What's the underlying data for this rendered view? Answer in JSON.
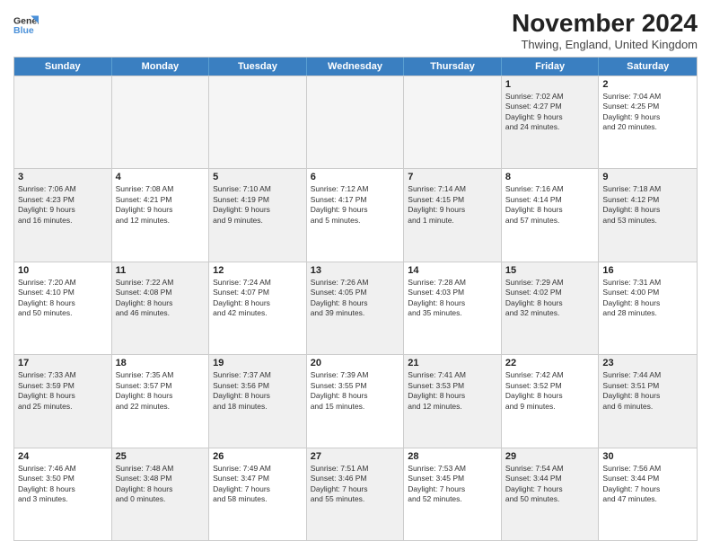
{
  "header": {
    "logo_line1": "General",
    "logo_line2": "Blue",
    "title": "November 2024",
    "location": "Thwing, England, United Kingdom"
  },
  "days_of_week": [
    "Sunday",
    "Monday",
    "Tuesday",
    "Wednesday",
    "Thursday",
    "Friday",
    "Saturday"
  ],
  "rows": [
    [
      {
        "day": "",
        "info": [],
        "empty": true
      },
      {
        "day": "",
        "info": [],
        "empty": true
      },
      {
        "day": "",
        "info": [],
        "empty": true
      },
      {
        "day": "",
        "info": [],
        "empty": true
      },
      {
        "day": "",
        "info": [],
        "empty": true
      },
      {
        "day": "1",
        "shaded": true,
        "info": [
          "Sunrise: 7:02 AM",
          "Sunset: 4:27 PM",
          "Daylight: 9 hours",
          "and 24 minutes."
        ]
      },
      {
        "day": "2",
        "info": [
          "Sunrise: 7:04 AM",
          "Sunset: 4:25 PM",
          "Daylight: 9 hours",
          "and 20 minutes."
        ]
      }
    ],
    [
      {
        "day": "3",
        "shaded": true,
        "info": [
          "Sunrise: 7:06 AM",
          "Sunset: 4:23 PM",
          "Daylight: 9 hours",
          "and 16 minutes."
        ]
      },
      {
        "day": "4",
        "info": [
          "Sunrise: 7:08 AM",
          "Sunset: 4:21 PM",
          "Daylight: 9 hours",
          "and 12 minutes."
        ]
      },
      {
        "day": "5",
        "shaded": true,
        "info": [
          "Sunrise: 7:10 AM",
          "Sunset: 4:19 PM",
          "Daylight: 9 hours",
          "and 9 minutes."
        ]
      },
      {
        "day": "6",
        "info": [
          "Sunrise: 7:12 AM",
          "Sunset: 4:17 PM",
          "Daylight: 9 hours",
          "and 5 minutes."
        ]
      },
      {
        "day": "7",
        "shaded": true,
        "info": [
          "Sunrise: 7:14 AM",
          "Sunset: 4:15 PM",
          "Daylight: 9 hours",
          "and 1 minute."
        ]
      },
      {
        "day": "8",
        "info": [
          "Sunrise: 7:16 AM",
          "Sunset: 4:14 PM",
          "Daylight: 8 hours",
          "and 57 minutes."
        ]
      },
      {
        "day": "9",
        "shaded": true,
        "info": [
          "Sunrise: 7:18 AM",
          "Sunset: 4:12 PM",
          "Daylight: 8 hours",
          "and 53 minutes."
        ]
      }
    ],
    [
      {
        "day": "10",
        "info": [
          "Sunrise: 7:20 AM",
          "Sunset: 4:10 PM",
          "Daylight: 8 hours",
          "and 50 minutes."
        ]
      },
      {
        "day": "11",
        "shaded": true,
        "info": [
          "Sunrise: 7:22 AM",
          "Sunset: 4:08 PM",
          "Daylight: 8 hours",
          "and 46 minutes."
        ]
      },
      {
        "day": "12",
        "info": [
          "Sunrise: 7:24 AM",
          "Sunset: 4:07 PM",
          "Daylight: 8 hours",
          "and 42 minutes."
        ]
      },
      {
        "day": "13",
        "shaded": true,
        "info": [
          "Sunrise: 7:26 AM",
          "Sunset: 4:05 PM",
          "Daylight: 8 hours",
          "and 39 minutes."
        ]
      },
      {
        "day": "14",
        "info": [
          "Sunrise: 7:28 AM",
          "Sunset: 4:03 PM",
          "Daylight: 8 hours",
          "and 35 minutes."
        ]
      },
      {
        "day": "15",
        "shaded": true,
        "info": [
          "Sunrise: 7:29 AM",
          "Sunset: 4:02 PM",
          "Daylight: 8 hours",
          "and 32 minutes."
        ]
      },
      {
        "day": "16",
        "info": [
          "Sunrise: 7:31 AM",
          "Sunset: 4:00 PM",
          "Daylight: 8 hours",
          "and 28 minutes."
        ]
      }
    ],
    [
      {
        "day": "17",
        "shaded": true,
        "info": [
          "Sunrise: 7:33 AM",
          "Sunset: 3:59 PM",
          "Daylight: 8 hours",
          "and 25 minutes."
        ]
      },
      {
        "day": "18",
        "info": [
          "Sunrise: 7:35 AM",
          "Sunset: 3:57 PM",
          "Daylight: 8 hours",
          "and 22 minutes."
        ]
      },
      {
        "day": "19",
        "shaded": true,
        "info": [
          "Sunrise: 7:37 AM",
          "Sunset: 3:56 PM",
          "Daylight: 8 hours",
          "and 18 minutes."
        ]
      },
      {
        "day": "20",
        "info": [
          "Sunrise: 7:39 AM",
          "Sunset: 3:55 PM",
          "Daylight: 8 hours",
          "and 15 minutes."
        ]
      },
      {
        "day": "21",
        "shaded": true,
        "info": [
          "Sunrise: 7:41 AM",
          "Sunset: 3:53 PM",
          "Daylight: 8 hours",
          "and 12 minutes."
        ]
      },
      {
        "day": "22",
        "info": [
          "Sunrise: 7:42 AM",
          "Sunset: 3:52 PM",
          "Daylight: 8 hours",
          "and 9 minutes."
        ]
      },
      {
        "day": "23",
        "shaded": true,
        "info": [
          "Sunrise: 7:44 AM",
          "Sunset: 3:51 PM",
          "Daylight: 8 hours",
          "and 6 minutes."
        ]
      }
    ],
    [
      {
        "day": "24",
        "info": [
          "Sunrise: 7:46 AM",
          "Sunset: 3:50 PM",
          "Daylight: 8 hours",
          "and 3 minutes."
        ]
      },
      {
        "day": "25",
        "shaded": true,
        "info": [
          "Sunrise: 7:48 AM",
          "Sunset: 3:48 PM",
          "Daylight: 8 hours",
          "and 0 minutes."
        ]
      },
      {
        "day": "26",
        "info": [
          "Sunrise: 7:49 AM",
          "Sunset: 3:47 PM",
          "Daylight: 7 hours",
          "and 58 minutes."
        ]
      },
      {
        "day": "27",
        "shaded": true,
        "info": [
          "Sunrise: 7:51 AM",
          "Sunset: 3:46 PM",
          "Daylight: 7 hours",
          "and 55 minutes."
        ]
      },
      {
        "day": "28",
        "info": [
          "Sunrise: 7:53 AM",
          "Sunset: 3:45 PM",
          "Daylight: 7 hours",
          "and 52 minutes."
        ]
      },
      {
        "day": "29",
        "shaded": true,
        "info": [
          "Sunrise: 7:54 AM",
          "Sunset: 3:44 PM",
          "Daylight: 7 hours",
          "and 50 minutes."
        ]
      },
      {
        "day": "30",
        "info": [
          "Sunrise: 7:56 AM",
          "Sunset: 3:44 PM",
          "Daylight: 7 hours",
          "and 47 minutes."
        ]
      }
    ]
  ]
}
